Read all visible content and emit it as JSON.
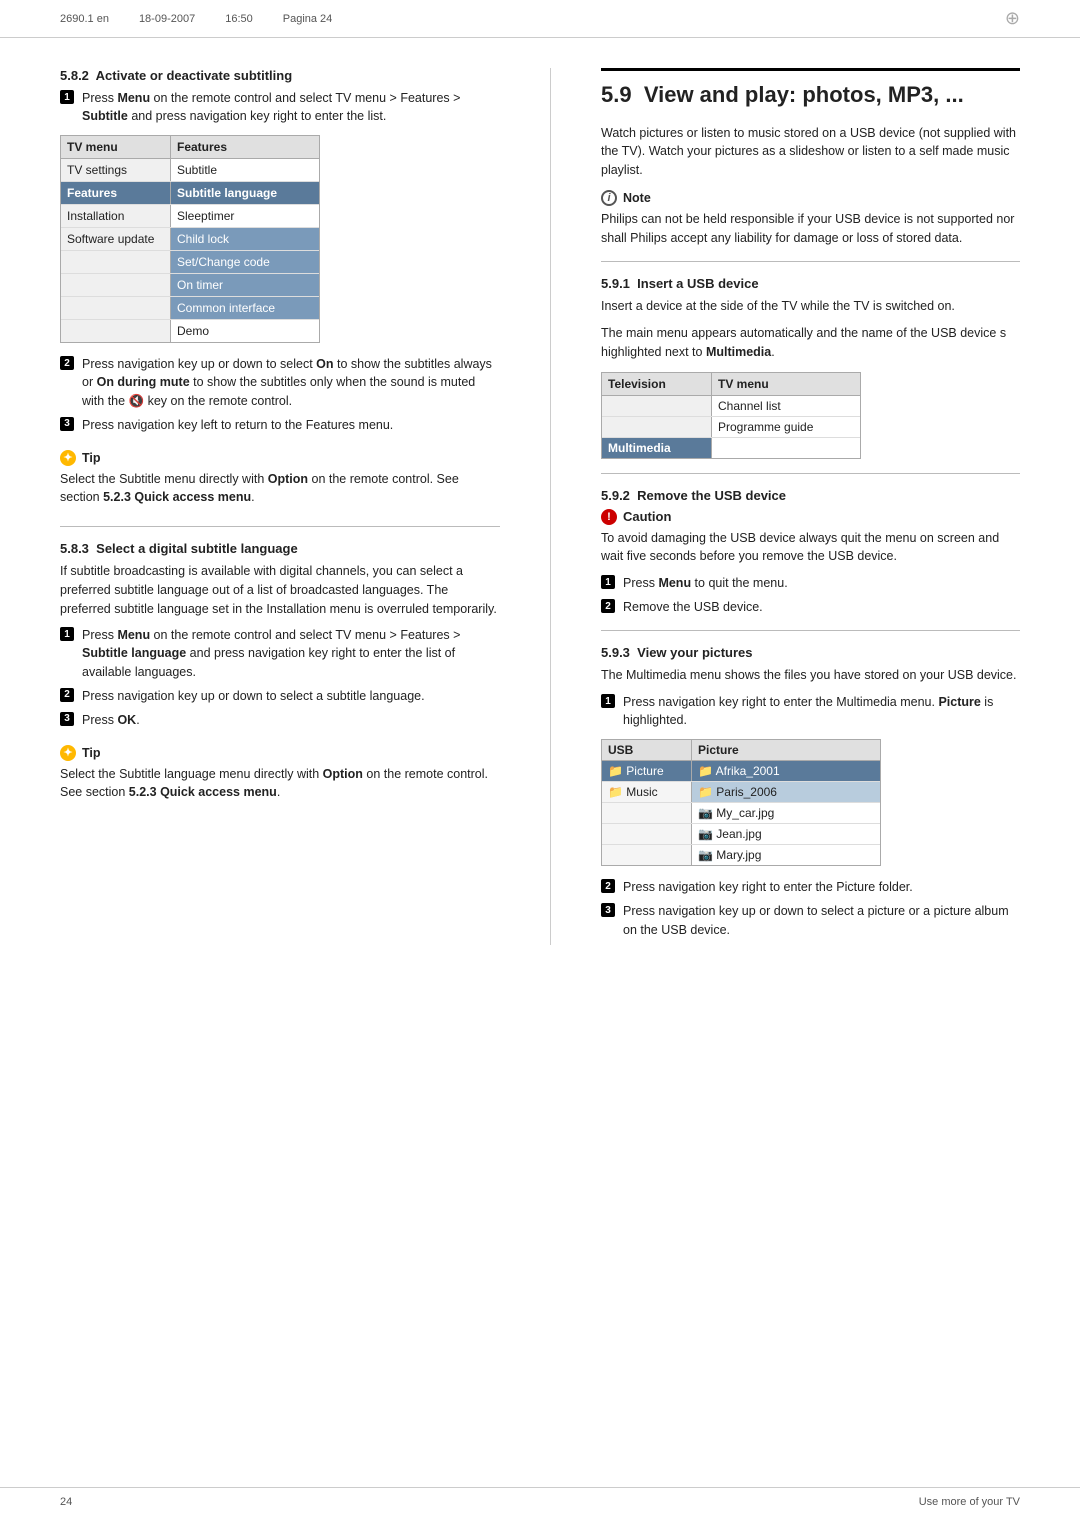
{
  "header": {
    "doc_ref": "2690.1 en",
    "date": "18-09-2007",
    "time": "16:50",
    "page_label": "Pagina 24"
  },
  "left_column": {
    "section_582": {
      "number": "5.8.2",
      "title": "Activate or deactivate subtitling",
      "step1": {
        "badge": "1",
        "text_parts": [
          "Press ",
          "Menu",
          " on the remote control and select TV menu > Features > ",
          "Subtitle",
          " and press navigation key right to enter the list."
        ]
      },
      "menu": {
        "col1_header": "TV menu",
        "col2_header": "Features",
        "rows": [
          {
            "col1": "TV settings",
            "col2": "Subtitle",
            "highlight": false
          },
          {
            "col1": "Features",
            "col2": "Subtitle language",
            "highlight": true,
            "col2_highlight": true
          },
          {
            "col1": "Installation",
            "col2": "Sleeptimer",
            "highlight": false
          },
          {
            "col1": "Software update",
            "col2": "Child lock",
            "highlight": false
          },
          {
            "col1": "",
            "col2": "Set/Change code",
            "highlight": false
          },
          {
            "col1": "",
            "col2": "On timer",
            "highlight": false
          },
          {
            "col1": "",
            "col2": "Common interface",
            "highlight": false
          },
          {
            "col1": "",
            "col2": "Demo",
            "highlight": false
          }
        ]
      },
      "step2": {
        "badge": "2",
        "text_parts": [
          "Press navigation key up or down to select ",
          "On",
          " to show the subtitles always or ",
          "On during mute",
          " to show the subtitles only when the sound is muted with the 🔇 key on the remote control."
        ]
      },
      "step3": {
        "badge": "3",
        "text": "Press navigation key left to return to the Features menu."
      },
      "tip": {
        "title": "Tip",
        "text_parts": [
          "Select the Subtitle menu directly with ",
          "Option",
          " on the remote control. See section ",
          "5.2.3 Quick access menu",
          "."
        ]
      }
    },
    "section_583": {
      "number": "5.8.3",
      "title": "Select a digital subtitle language",
      "intro": "If subtitle broadcasting is available with digital channels, you can select a preferred subtitle language out of a list of broadcasted languages. The preferred subtitle language set in the Installation menu is overruled temporarily.",
      "step1": {
        "badge": "1",
        "text_parts": [
          "Press ",
          "Menu",
          " on the remote control and select TV menu > Features > ",
          "Subtitle language",
          " and press navigation key right to enter the list of available languages."
        ]
      },
      "step2": {
        "badge": "2",
        "text": "Press navigation key up or down to select a subtitle language."
      },
      "step3": {
        "badge": "3",
        "text_parts": [
          "Press ",
          "OK",
          "."
        ]
      },
      "tip": {
        "title": "Tip",
        "text_parts": [
          "Select the Subtitle language menu directly with ",
          "Option",
          " on the remote control. See section ",
          "5.2.3 Quick access menu",
          "."
        ]
      }
    }
  },
  "right_column": {
    "section_59": {
      "number": "5.9",
      "title": "View and play: photos, MP3, ...",
      "intro": "Watch pictures or listen to music stored on a USB device (not supplied with the TV). Watch your pictures as a slideshow or listen to a self made music playlist.",
      "note": {
        "title": "Note",
        "text": "Philips can not be held responsible if your USB device is not supported nor shall Philips accept any liability for damage or loss of stored data."
      }
    },
    "section_591": {
      "number": "5.9.1",
      "title": "Insert a USB device",
      "intro": "Insert a device at the side of the TV while the TV is switched on.",
      "text2": "The main menu appears automatically and the name of the USB device s highlighted next to Multimedia.",
      "multimedia_bold": "Multimedia",
      "menu": {
        "col1_header": "Television",
        "col2_header": "TV menu",
        "rows": [
          {
            "col1": "",
            "col2": "Channel list"
          },
          {
            "col1": "",
            "col2": "Programme guide"
          },
          {
            "col1": "Multimedia",
            "col2": "",
            "highlight": true
          }
        ]
      }
    },
    "section_592": {
      "number": "5.9.2",
      "title": "Remove the USB device",
      "caution": {
        "title": "Caution",
        "text": "To avoid damaging the USB device always quit the menu on screen and wait five seconds before you remove the USB device."
      },
      "step1": {
        "badge": "1",
        "text_parts": [
          "Press ",
          "Menu",
          " to quit the menu."
        ]
      },
      "step2": {
        "badge": "2",
        "text": "Remove the USB device."
      }
    },
    "section_593": {
      "number": "5.9.3",
      "title": "View your pictures",
      "intro": "The Multimedia menu shows the files you have stored on your USB device.",
      "step1": {
        "badge": "1",
        "text_parts": [
          "Press navigation key right to enter the Multimedia menu. ",
          "Picture",
          " is highlighted."
        ]
      },
      "usb_menu": {
        "col1_header": "USB",
        "col2_header": "Picture",
        "rows": [
          {
            "col1": "📁 Picture",
            "col2": "📁 Afrika_2001",
            "col2_highlight": true
          },
          {
            "col1": "📁 Music",
            "col2": "📁 Paris_2006",
            "col2_sub": true
          },
          {
            "col1": "",
            "col2": "🖼 My_car.jpg"
          },
          {
            "col1": "",
            "col2": "🖼 Jean.jpg"
          },
          {
            "col1": "",
            "col2": "🖼 Mary.jpg"
          }
        ]
      },
      "step2": {
        "badge": "2",
        "text": "Press navigation key right to enter the Picture folder."
      },
      "step3": {
        "badge": "3",
        "text": "Press navigation key up or down to select a picture or a picture album on the USB device."
      }
    }
  },
  "footer": {
    "page_number": "24",
    "right_text": "Use more of your TV"
  }
}
